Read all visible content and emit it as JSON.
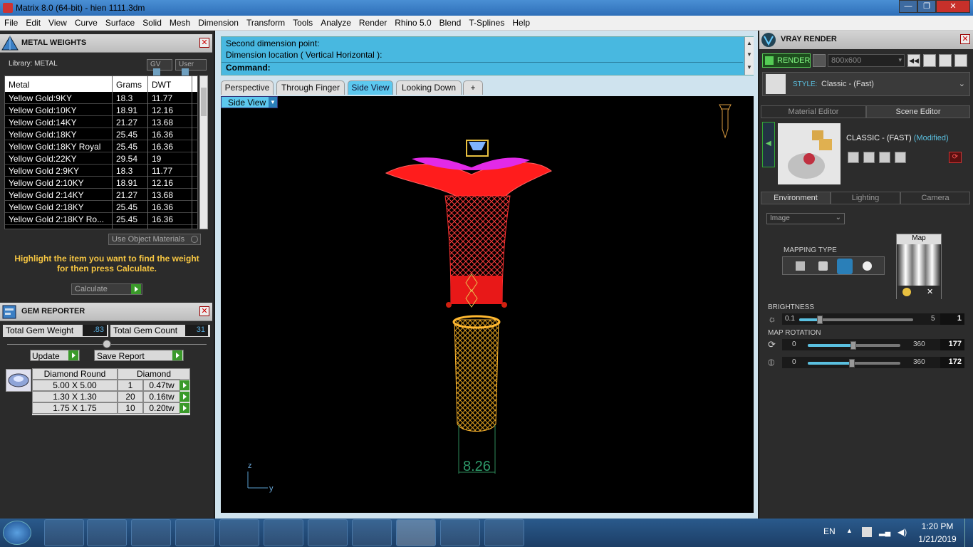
{
  "window": {
    "title": "Matrix 8.0 (64-bit) - hien 1111.3dm"
  },
  "menu": [
    "File",
    "Edit",
    "View",
    "Curve",
    "Surface",
    "Solid",
    "Mesh",
    "Dimension",
    "Transform",
    "Tools",
    "Analyze",
    "Render",
    "Rhino 5.0",
    "Blend",
    "T-Splines",
    "Help"
  ],
  "metal_weights": {
    "title": "METAL WEIGHTS",
    "library": "Library: METAL",
    "gv": "GV",
    "user": "User",
    "columns": [
      "Metal",
      "Grams",
      "DWT"
    ],
    "rows": [
      [
        "Yellow Gold:9KY",
        "18.3",
        "11.77"
      ],
      [
        "Yellow Gold:10KY",
        "18.91",
        "12.16"
      ],
      [
        "Yellow Gold:14KY",
        "21.27",
        "13.68"
      ],
      [
        "Yellow Gold:18KY",
        "25.45",
        "16.36"
      ],
      [
        "Yellow Gold:18KY Royal",
        "25.45",
        "16.36"
      ],
      [
        "Yellow Gold:22KY",
        "29.54",
        "19"
      ],
      [
        "Yellow Gold 2:9KY",
        "18.3",
        "11.77"
      ],
      [
        "Yellow Gold 2:10KY",
        "18.91",
        "12.16"
      ],
      [
        "Yellow Gold 2:14KY",
        "21.27",
        "13.68"
      ],
      [
        "Yellow Gold 2:18KY",
        "25.45",
        "16.36"
      ],
      [
        "Yellow Gold 2:18KY Ro...",
        "25.45",
        "16.36"
      ]
    ],
    "use_object_materials": "Use Object Materials",
    "hint": "Highlight the item you want to find the weight for then press Calculate.",
    "calculate": "Calculate"
  },
  "gem_reporter": {
    "title": "GEM REPORTER",
    "total_weight_label": "Total Gem Weight",
    "total_weight": ".83",
    "total_count_label": "Total Gem Count",
    "total_count": "31",
    "update": "Update",
    "save_report": "Save Report",
    "columns": [
      "Diamond Round",
      "Diamond"
    ],
    "rows": [
      [
        "5.00 X 5.00",
        "1",
        "0.47tw"
      ],
      [
        "1.30 X 1.30",
        "20",
        "0.16tw"
      ],
      [
        "1.75 X 1.75",
        "10",
        "0.20tw"
      ]
    ]
  },
  "command": {
    "line1": "Second dimension point:",
    "line2": "Dimension location ( Vertical  Horizontal ):",
    "prompt": "Command:"
  },
  "viewport_tabs": [
    "Perspective",
    "Through Finger",
    "Side View",
    "Looking Down"
  ],
  "active_tab": "Side View",
  "viewport": {
    "label": "Side View",
    "dimension": "8.26",
    "axis_z": "z",
    "axis_y": "y"
  },
  "vray": {
    "title": "VRAY RENDER",
    "render": "RENDER",
    "resolution": "800x600",
    "style_label": "STYLE:",
    "style_value": "Classic - (Fast)",
    "tab_material": "Material Editor",
    "tab_scene": "Scene Editor",
    "scene_name": "CLASSIC - (FAST)",
    "scene_modified": "(Modified)",
    "env_tabs": [
      "Environment",
      "Lighting",
      "Camera"
    ],
    "env_select": "Image",
    "map_label": "Map",
    "mapping_type": "MAPPING TYPE",
    "brightness": {
      "label": "BRIGHTNESS",
      "min": "0.1",
      "max": "5",
      "value": "1",
      "level": 0.18
    },
    "map_rotation": {
      "label": "MAP ROTATION",
      "min": "0",
      "max": "360",
      "value1": "177",
      "value2": "172",
      "level1": 0.49,
      "level2": 0.48
    }
  },
  "taskbar": {
    "lang": "EN",
    "time": "1:20 PM",
    "date": "1/21/2019"
  }
}
